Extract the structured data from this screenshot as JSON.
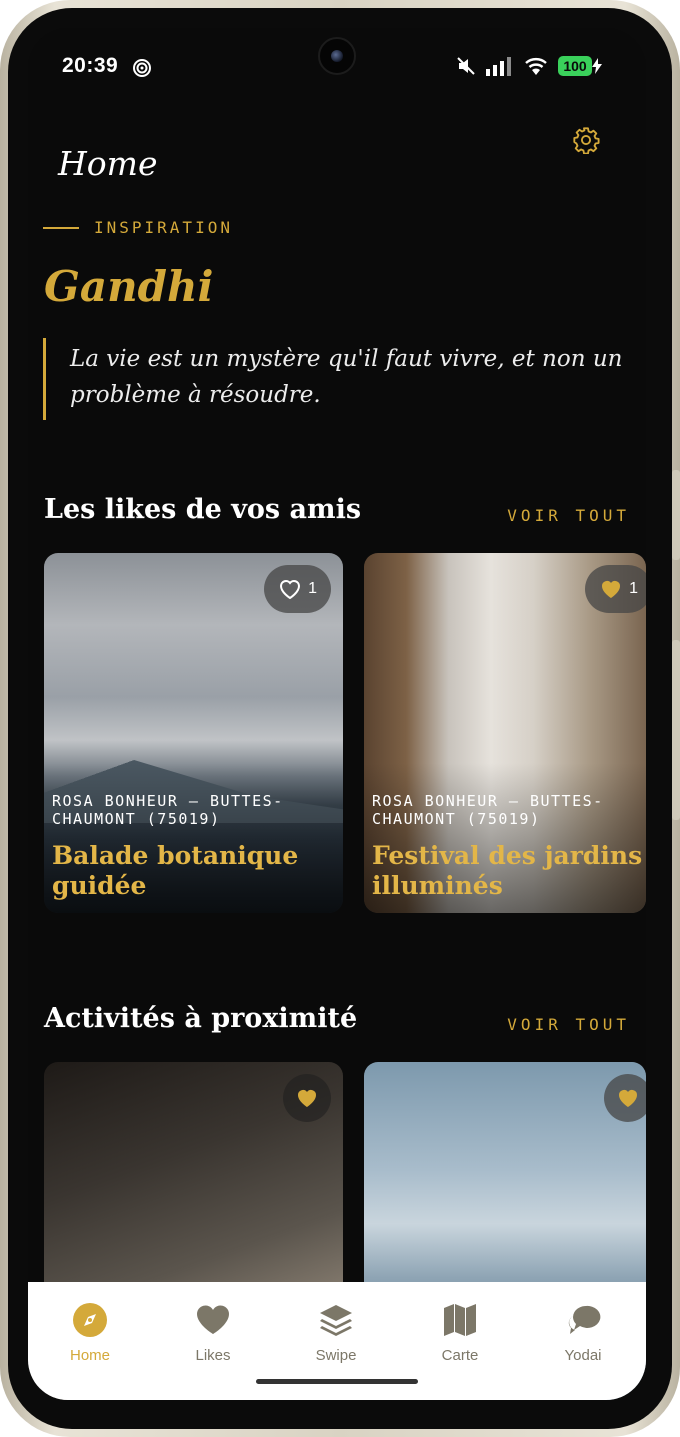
{
  "status": {
    "time": "20:39",
    "battery": "100"
  },
  "header": {
    "title": "Home",
    "settings_icon": "gear-icon"
  },
  "inspiration": {
    "label": "INSPIRATION",
    "author": "Gandhi",
    "quote": "La vie est un mystère qu'il faut vivre, et non un problème à résoudre."
  },
  "friends_likes": {
    "title": "Les likes de vos amis",
    "see_all": "VOIR TOUT",
    "cards": [
      {
        "location": "ROSA BONHEUR — BUTTES-CHAUMONT (75019)",
        "title": "Balade botanique guidée",
        "likes": "1",
        "liked": false
      },
      {
        "location": "ROSA BONHEUR — BUTTES-CHAUMONT (75019)",
        "title": "Festival des jardins illuminés",
        "likes": "1",
        "liked": true
      }
    ]
  },
  "nearby": {
    "title": "Activités à proximité",
    "see_all": "VOIR TOUT"
  },
  "tabs": [
    {
      "label": "Home",
      "icon": "compass-icon",
      "active": true
    },
    {
      "label": "Likes",
      "icon": "heart-icon",
      "active": false
    },
    {
      "label": "Swipe",
      "icon": "layers-icon",
      "active": false
    },
    {
      "label": "Carte",
      "icon": "map-icon",
      "active": false
    },
    {
      "label": "Yodai",
      "icon": "chat-icon",
      "active": false
    }
  ],
  "colors": {
    "accent": "#d4a93a",
    "background": "#0a0a0a",
    "tab_inactive": "#7c7768"
  }
}
